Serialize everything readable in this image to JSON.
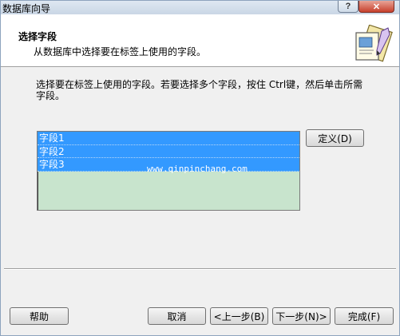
{
  "window": {
    "title": "数据库向导",
    "help_glyph": "?",
    "close_glyph": "✕"
  },
  "header": {
    "title": "选择字段",
    "subtitle": "从数据库中选择要在标签上使用的字段。"
  },
  "instruction": "选择要在标签上使用的字段。若要选择多个字段，按住 Ctrl键，然后单击所需字段。",
  "fields": {
    "items": [
      "字段1",
      "字段2",
      "字段3"
    ],
    "watermark": "www.qinpinchang.com"
  },
  "buttons": {
    "define": "定义(D)",
    "help": "帮助",
    "cancel": "取消",
    "prev": "<上一步(B)",
    "next": "下一步(N)>",
    "finish": "完成(F)"
  },
  "colors": {
    "selection": "#3399ff",
    "list_background": "#c8e4cd",
    "close_button": "#c7402c"
  }
}
